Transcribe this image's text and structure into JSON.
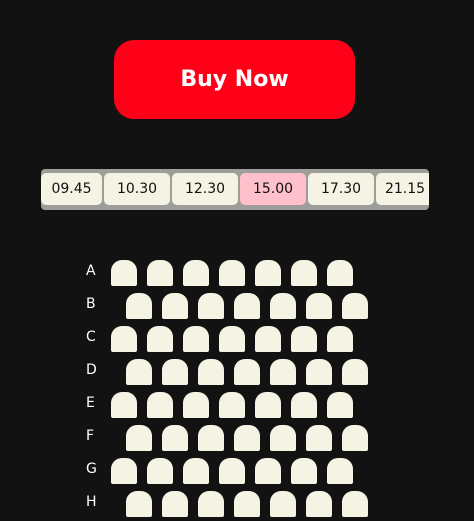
{
  "buy_button": {
    "label": "Buy Now"
  },
  "showtimes": {
    "times": [
      "09.45",
      "10.30",
      "12.30",
      "15.00",
      "17.30",
      "21.15"
    ],
    "selected": "15.00"
  },
  "seating": {
    "rows": [
      {
        "label": "A",
        "seats": 7
      },
      {
        "label": "B",
        "seats": 7
      },
      {
        "label": "C",
        "seats": 7
      },
      {
        "label": "D",
        "seats": 7
      },
      {
        "label": "E",
        "seats": 7
      },
      {
        "label": "F",
        "seats": 7
      },
      {
        "label": "G",
        "seats": 7
      },
      {
        "label": "H",
        "seats": 7
      }
    ]
  },
  "colors": {
    "background": "#121212",
    "button": "#ff0019",
    "seat": "#f5f3e3",
    "time_slot": "#f5f3e3",
    "time_slot_selected": "#ffc0cb",
    "time_bar": "#9d9d9a"
  }
}
